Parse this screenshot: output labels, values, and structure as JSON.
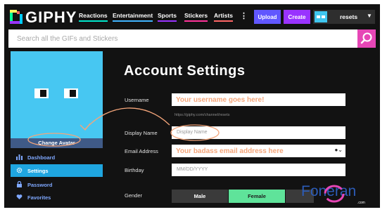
{
  "logo": {
    "text": "GIPHY"
  },
  "nav": {
    "items": [
      {
        "label": "Reactions",
        "color": "#00e6cc"
      },
      {
        "label": "Entertainment",
        "color": "#3fb4ff"
      },
      {
        "label": "Sports",
        "color": "#9933ff"
      },
      {
        "label": "Stickers",
        "color": "#ff3399"
      },
      {
        "label": "Artists",
        "color": "#ff6666"
      }
    ],
    "more": "⋮",
    "upload_label": "Upload",
    "create_label": "Create",
    "username": "resets"
  },
  "search": {
    "placeholder": "Search all the GIFs and Stickers"
  },
  "avatar": {
    "change_label": "Change Avatar"
  },
  "sidebar": {
    "items": [
      {
        "label": "Dashboard",
        "icon": "bar-chart-icon",
        "active": false
      },
      {
        "label": "Settings",
        "icon": "gear-icon",
        "active": true
      },
      {
        "label": "Password",
        "icon": "lock-icon",
        "active": false
      },
      {
        "label": "Favorites",
        "icon": "heart-icon",
        "active": false
      }
    ]
  },
  "main": {
    "title": "Account Settings",
    "username": {
      "label": "Username",
      "value": "Your username goes here!",
      "hint": "https://giphy.com/channel/resets"
    },
    "display_name": {
      "label": "Display Name",
      "placeholder": "Display Name"
    },
    "email": {
      "label": "Email Address",
      "value": "Your badass email address here"
    },
    "birthday": {
      "label": "Birthday",
      "placeholder": "MM/DD/YYYY"
    },
    "gender": {
      "label": "Gender",
      "options": [
        "Male",
        "Female"
      ],
      "selected": "Female"
    }
  },
  "watermark": {
    "text": "Foneran",
    "sub": ".com"
  },
  "colors": {
    "annotation": "#f4a57a",
    "accent_green": "#5fe39a"
  }
}
